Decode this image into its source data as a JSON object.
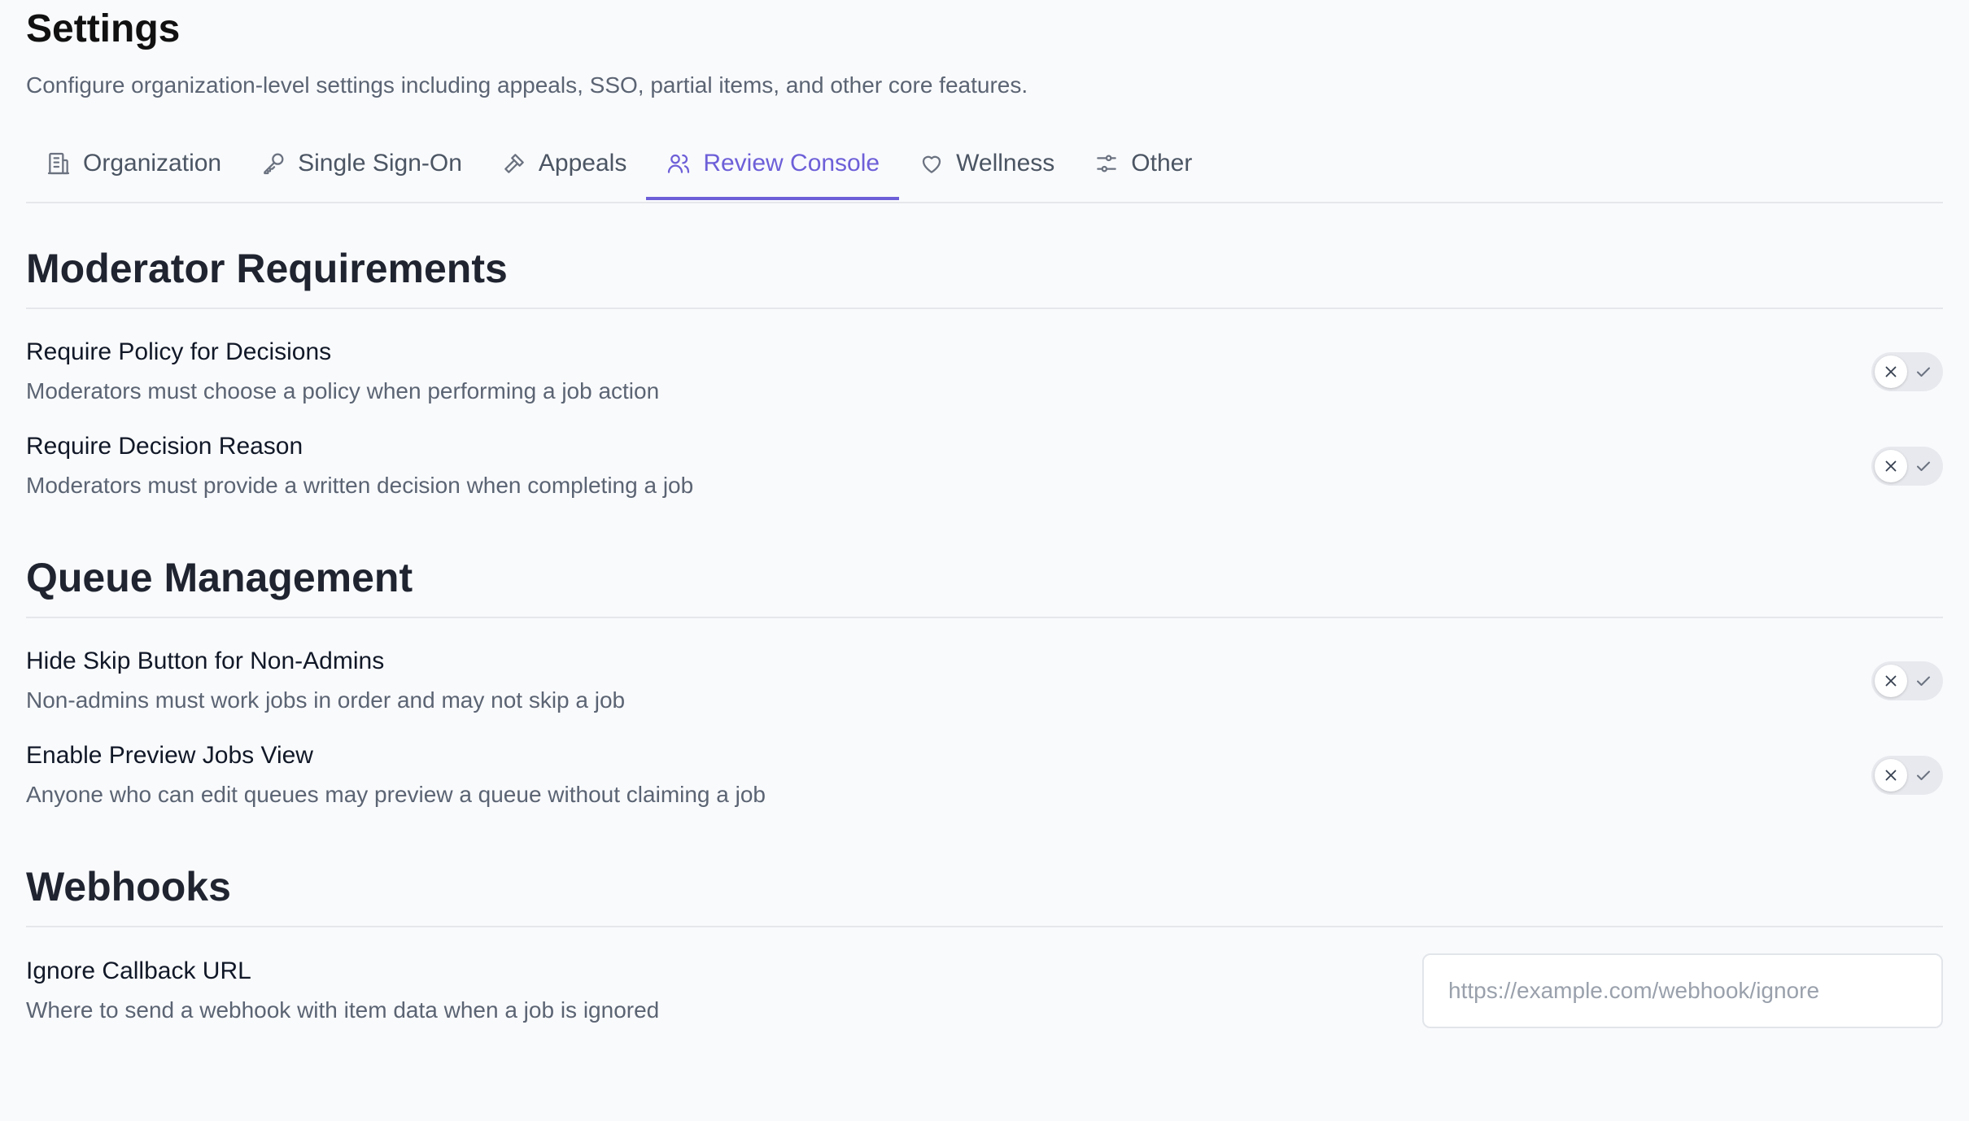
{
  "header": {
    "title": "Settings",
    "subtitle": "Configure organization-level settings including appeals, SSO, partial items, and other core features."
  },
  "tabs": [
    {
      "label": "Organization",
      "icon": "building-icon",
      "active": false
    },
    {
      "label": "Single Sign-On",
      "icon": "key-icon",
      "active": false
    },
    {
      "label": "Appeals",
      "icon": "gavel-icon",
      "active": false
    },
    {
      "label": "Review Console",
      "icon": "users-icon",
      "active": true
    },
    {
      "label": "Wellness",
      "icon": "heart-icon",
      "active": false
    },
    {
      "label": "Other",
      "icon": "sliders-icon",
      "active": false
    }
  ],
  "sections": {
    "moderator": {
      "title": "Moderator Requirements",
      "items": [
        {
          "label": "Require Policy for Decisions",
          "description": "Moderators must choose a policy when performing a job action",
          "enabled": false
        },
        {
          "label": "Require Decision Reason",
          "description": "Moderators must provide a written decision when completing a job",
          "enabled": false
        }
      ]
    },
    "queue": {
      "title": "Queue Management",
      "items": [
        {
          "label": "Hide Skip Button for Non-Admins",
          "description": "Non-admins must work jobs in order and may not skip a job",
          "enabled": false
        },
        {
          "label": "Enable Preview Jobs View",
          "description": "Anyone who can edit queues may preview a queue without claiming a job",
          "enabled": false
        }
      ]
    },
    "webhooks": {
      "title": "Webhooks",
      "items": [
        {
          "label": "Ignore Callback URL",
          "description": "Where to send a webhook with item data when a job is ignored",
          "value": "",
          "placeholder": "https://example.com/webhook/ignore"
        }
      ]
    }
  },
  "colors": {
    "accent": "#6d5fd8",
    "toggle_off": "#e7e9ee",
    "muted_text": "#5b6473"
  }
}
